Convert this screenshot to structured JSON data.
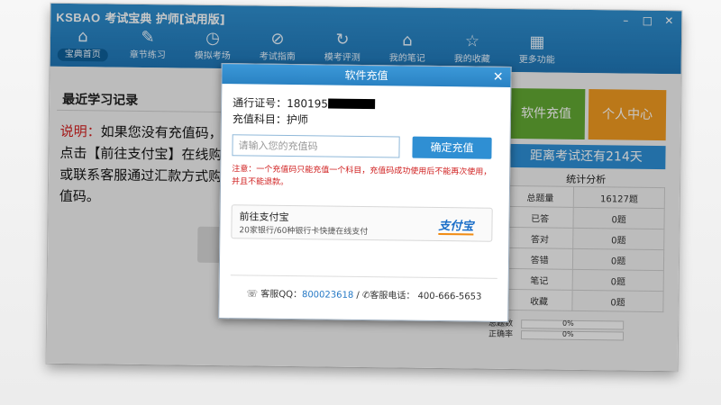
{
  "app": {
    "logo": "KSBAO",
    "title": "考试宝典 护师[试用版]",
    "window_controls": {
      "minimize": "–",
      "maximize": "□",
      "close": "✕"
    }
  },
  "toolbar": {
    "items": [
      {
        "label": "宝典首页",
        "icon": "home-icon",
        "glyph": "⌂",
        "active": true
      },
      {
        "label": "章节练习",
        "icon": "edit-icon",
        "glyph": "✎",
        "active": false
      },
      {
        "label": "模拟考场",
        "icon": "clock-icon",
        "glyph": "◷",
        "active": false
      },
      {
        "label": "考试指南",
        "icon": "compass-icon",
        "glyph": "⊘",
        "active": false
      },
      {
        "label": "模考评测",
        "icon": "refresh-icon",
        "glyph": "↻",
        "active": false
      },
      {
        "label": "我的笔记",
        "icon": "tag-icon",
        "glyph": "⌂",
        "active": false
      },
      {
        "label": "我的收藏",
        "icon": "star-icon",
        "glyph": "☆",
        "active": false
      },
      {
        "label": "更多功能",
        "icon": "grid-icon",
        "glyph": "▦",
        "active": false
      }
    ]
  },
  "main": {
    "section_title": "最近学习记录",
    "note_prefix": "说明：",
    "note_text": "如果您没有充值码，请点击【前往支付宝】在线购买，或联系客服通过汇款方式购买充值码。"
  },
  "side": {
    "recharge_tile": "软件充值",
    "profile_tile": "个人中心",
    "countdown": "距离考试还有214天",
    "stats_title": "统计分析",
    "stats": [
      {
        "k": "总题量",
        "v": "16127题"
      },
      {
        "k": "已答",
        "v": "0题"
      },
      {
        "k": "答对",
        "v": "0题"
      },
      {
        "k": "答错",
        "v": "0题"
      },
      {
        "k": "笔记",
        "v": "0题"
      },
      {
        "k": "收藏",
        "v": "0题"
      }
    ],
    "progress": [
      {
        "label": "总题数",
        "value": "0%"
      },
      {
        "label": "正确率",
        "value": "0%"
      }
    ]
  },
  "modal": {
    "title": "软件充值",
    "close": "✕",
    "pass_label": "通行证号：",
    "pass_value": "180195",
    "subject_label": "充值科目：",
    "subject_value": "护师",
    "code_placeholder": "请输入您的充值码",
    "confirm_label": "确定充值",
    "warning": "注意：一个充值码只能充值一个科目，充值码成功使用后不能再次使用，并且不能退款。",
    "pay_title": "前往支付宝",
    "pay_sub": "20家银行/60种银行卡快捷在线支付",
    "alipay_logo": "支付宝",
    "qq_label": "客服QQ：",
    "qq_value": "800023618",
    "separator": "/",
    "phone_label": "客服电话：",
    "phone_value": "400-666-5653"
  }
}
